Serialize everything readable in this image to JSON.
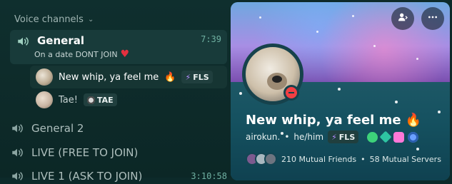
{
  "sidebar": {
    "section_label": "Voice channels",
    "channels": [
      {
        "name": "General",
        "timer": "7:39",
        "status": "On a date DONT JOIN",
        "members": [
          {
            "name": "New whip, ya feel me",
            "tag": "FLS"
          },
          {
            "name": "Tae!",
            "tag": "TAE"
          }
        ]
      },
      {
        "name": "General 2"
      },
      {
        "name": "LIVE (FREE TO JOIN)"
      },
      {
        "name": "LIVE 1 (ASK TO JOIN)",
        "timer": "3:10:58"
      }
    ]
  },
  "profile": {
    "display_name": "New whip, ya feel me",
    "username": "airokun.",
    "pronouns": "he/him",
    "tag": "FLS",
    "mutual_friends": "210 Mutual Friends",
    "mutual_servers": "58 Mutual Servers",
    "status": "do-not-disturb"
  },
  "icons": {
    "channel": "speaker-icon",
    "add_friend": "person-icon",
    "more": "more-icon"
  },
  "colors": {
    "accent": "#0f6b75",
    "timer": "#6fb0a1",
    "dnd": "#f23f43"
  }
}
